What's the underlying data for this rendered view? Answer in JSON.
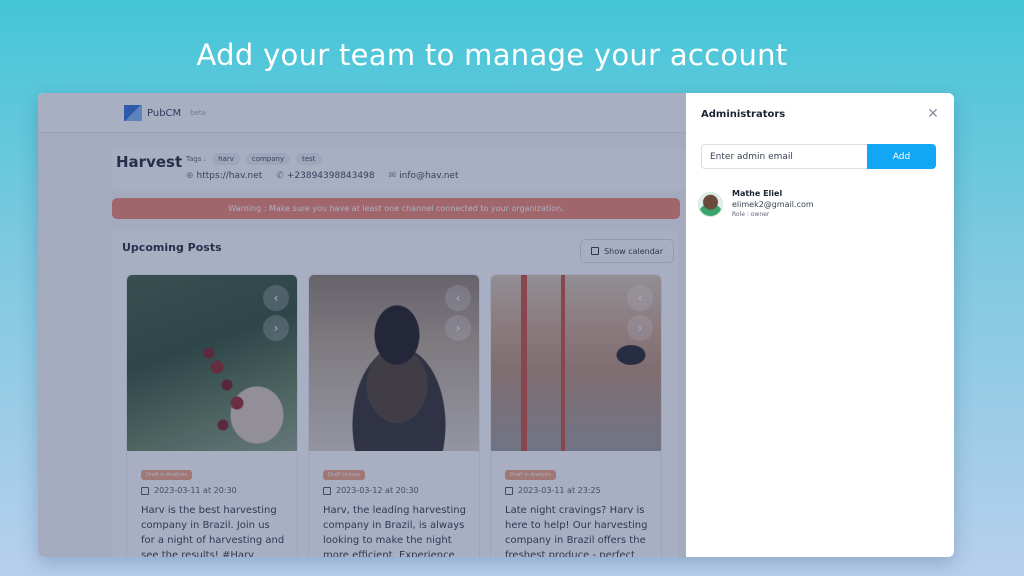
{
  "headline": "Add your team to manage your account",
  "app": {
    "brand": "PubCM",
    "brand_sub": "beta",
    "org": {
      "name": "Harvest",
      "tags_label": "Tags :",
      "tags": [
        "harv",
        "company",
        "test"
      ],
      "website": "https://hav.net",
      "phone": "+23894398843498",
      "email": "info@hav.net"
    },
    "warning": "Warning : Make sure you have at least one channel connected to your organization.",
    "posts": {
      "title": "Upcoming Posts",
      "show_calendar": "Show calendar",
      "items": [
        {
          "badge": "Draft in Analysis",
          "date": "2023-03-11 at 20:30",
          "text": "Harv is the best harvesting company in Brazil. Join us for a night of harvesting and see the results! #Harv #Company #Test"
        },
        {
          "badge": "Draft Unsure",
          "date": "2023-03-12 at 20:30",
          "text": "Harv, the leading harvesting company in Brazil, is always looking to make the night more efficient. Experience harvesting excellence with Harv!"
        },
        {
          "badge": "Draft in Analysis",
          "date": "2023-03-11 at 23:25",
          "text": "Late night cravings? Harv is here to help! Our harvesting company in Brazil offers the freshest produce - perfect for a late-night snack! #Harv"
        }
      ]
    }
  },
  "drawer": {
    "title": "Administrators",
    "close_icon": "close-icon",
    "input_placeholder": "Enter admin email",
    "add_label": "Add",
    "admins": [
      {
        "name": "Mathe Eliel",
        "email": "elimek2@gmail.com",
        "role": "Role : owner"
      }
    ]
  },
  "colors": {
    "accent": "#12a7f5",
    "warning": "#f1826b",
    "background_top": "#45c6d8",
    "background_bottom": "#b7cfec"
  }
}
